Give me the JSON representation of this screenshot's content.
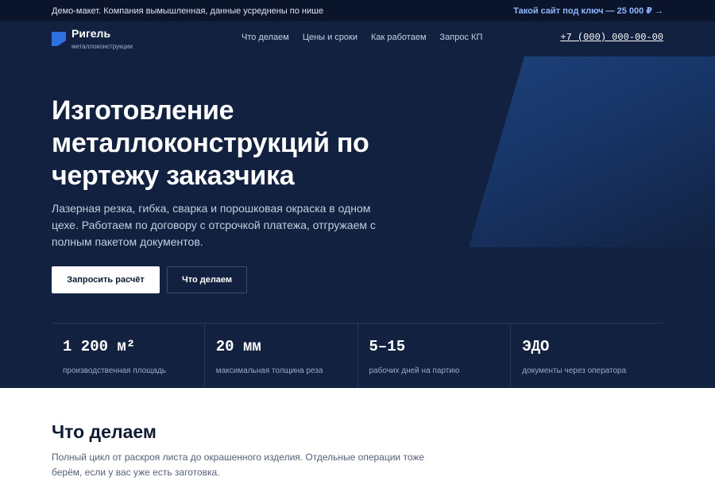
{
  "topbar": {
    "note": "Демо-макет. Компания вымышленная, данные усреднены по нише",
    "promo": "Такой сайт под ключ — 25 000 ₽ →"
  },
  "header": {
    "logo_name": "Ригель",
    "logo_sub": "металлоконструкции",
    "nav": [
      "Что делаем",
      "Цены и сроки",
      "Как работаем",
      "Запрос КП"
    ],
    "phone": "+7 (000) 000-00-00"
  },
  "hero": {
    "title": "Изготовление металлоконструкций по чертежу заказчика",
    "subtitle": "Лазерная резка, гибка, сварка и порошковая окраска в одном цехе. Работаем по договору с отсрочкой платежа, отгружаем с полным пакетом документов.",
    "primary_button": "Запросить расчёт",
    "secondary_button": "Что делаем"
  },
  "stats": [
    {
      "value": "1 200 м²",
      "label": "производственная площадь"
    },
    {
      "value": "20 мм",
      "label": "максимальная толщина реза"
    },
    {
      "value": "5–15",
      "label": "рабочих дней на партию"
    },
    {
      "value": "ЭДО",
      "label": "документы через оператора"
    }
  ],
  "services": {
    "title": "Что делаем",
    "subtitle": "Полный цикл от раскроя листа до окрашенного изделия. Отдельные операции тоже берём, если у вас уже есть заготовка."
  },
  "colors": {
    "hero_bg": "#12213f",
    "topbar_bg": "#0a152b",
    "accent": "#2f6fe0",
    "promo": "#8fb6ff"
  }
}
